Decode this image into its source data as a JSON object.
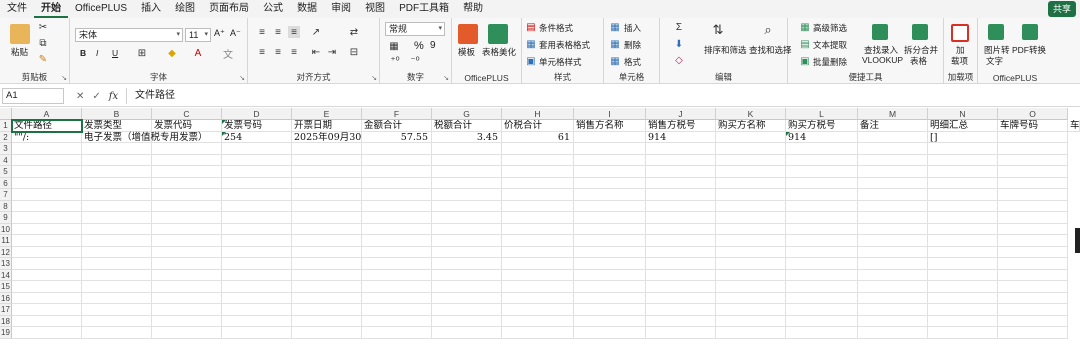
{
  "menu": {
    "tabs": [
      "文件",
      "开始",
      "OfficePLUS",
      "插入",
      "绘图",
      "页面布局",
      "公式",
      "数据",
      "审阅",
      "视图",
      "PDF工具箱",
      "帮助"
    ],
    "active_index": 1,
    "share_label": "共享"
  },
  "ribbon": {
    "clipboard": {
      "paste": "粘贴",
      "label": "剪贴板"
    },
    "font": {
      "name": "宋体",
      "size": "11",
      "bold": "B",
      "italic": "I",
      "underline": "U",
      "grow": "A⁺",
      "shrink": "A⁻",
      "label": "字体"
    },
    "alignment": {
      "label": "对齐方式"
    },
    "number": {
      "format": "常规",
      "percent": "%",
      "comma": "9",
      "label": "数字"
    },
    "officeplus": {
      "template": "模板",
      "beautify": "表格美化",
      "label": "OfficePLUS"
    },
    "styles": {
      "conditional": "条件格式",
      "table_format": "套用表格格式",
      "cell_styles": "单元格样式",
      "label": "样式"
    },
    "cells": {
      "insert": "插入",
      "delete": "删除",
      "format": "格式",
      "label": "单元格"
    },
    "editing": {
      "sort_filter": "排序和筛选",
      "find_select": "查找和选择",
      "label": "编辑"
    },
    "tools": {
      "advanced_filter": "高级筛选",
      "text_extract": "文本提取",
      "batch_delete": "批量删除",
      "vlookup_line1": "查找录入",
      "vlookup_line2": "VLOOKUP",
      "split_line1": "拆分合并",
      "split_line2": "表格",
      "label": "便捷工具"
    },
    "addins": {
      "addin": "加载项",
      "addin_line1": "加",
      "addin_line2": "载项",
      "label": "加载项"
    },
    "op2": {
      "img_line1": "图片转",
      "img_line2": "文字",
      "pdf_line1": "PDF转换",
      "label": "OfficePLUS"
    }
  },
  "formula_bar": {
    "cell_ref": "A1",
    "cancel": "✕",
    "confirm": "✓",
    "fx": "fx",
    "content": "文件路径"
  },
  "sheet": {
    "columns": [
      "A",
      "B",
      "C",
      "D",
      "E",
      "F",
      "G",
      "H",
      "I",
      "J",
      "K",
      "L",
      "M",
      "N",
      "O"
    ],
    "row_numbers": [
      "1",
      "2",
      "3",
      "4",
      "5",
      "6",
      "7",
      "8",
      "9",
      "10",
      "11",
      "12",
      "13",
      "14",
      "15",
      "16",
      "17",
      "18",
      "19"
    ],
    "row1": [
      "文件路径",
      "发票类型",
      "发票代码",
      "发票号码",
      "开票日期",
      "金额合计",
      "税额合计",
      "价税合计",
      "销售方名称",
      "销售方税号",
      "购买方名称",
      "购买方税号",
      "备注",
      "明细汇总",
      "车牌号码"
    ],
    "row2": [
      "\"\"/:",
      "电子发票（增值税专用发票）",
      "",
      "254",
      "2025年09月30日",
      "57.55",
      "3.45",
      "61",
      "",
      "914",
      "",
      "914",
      "",
      "[]",
      ""
    ],
    "overflow_header": "车"
  }
}
